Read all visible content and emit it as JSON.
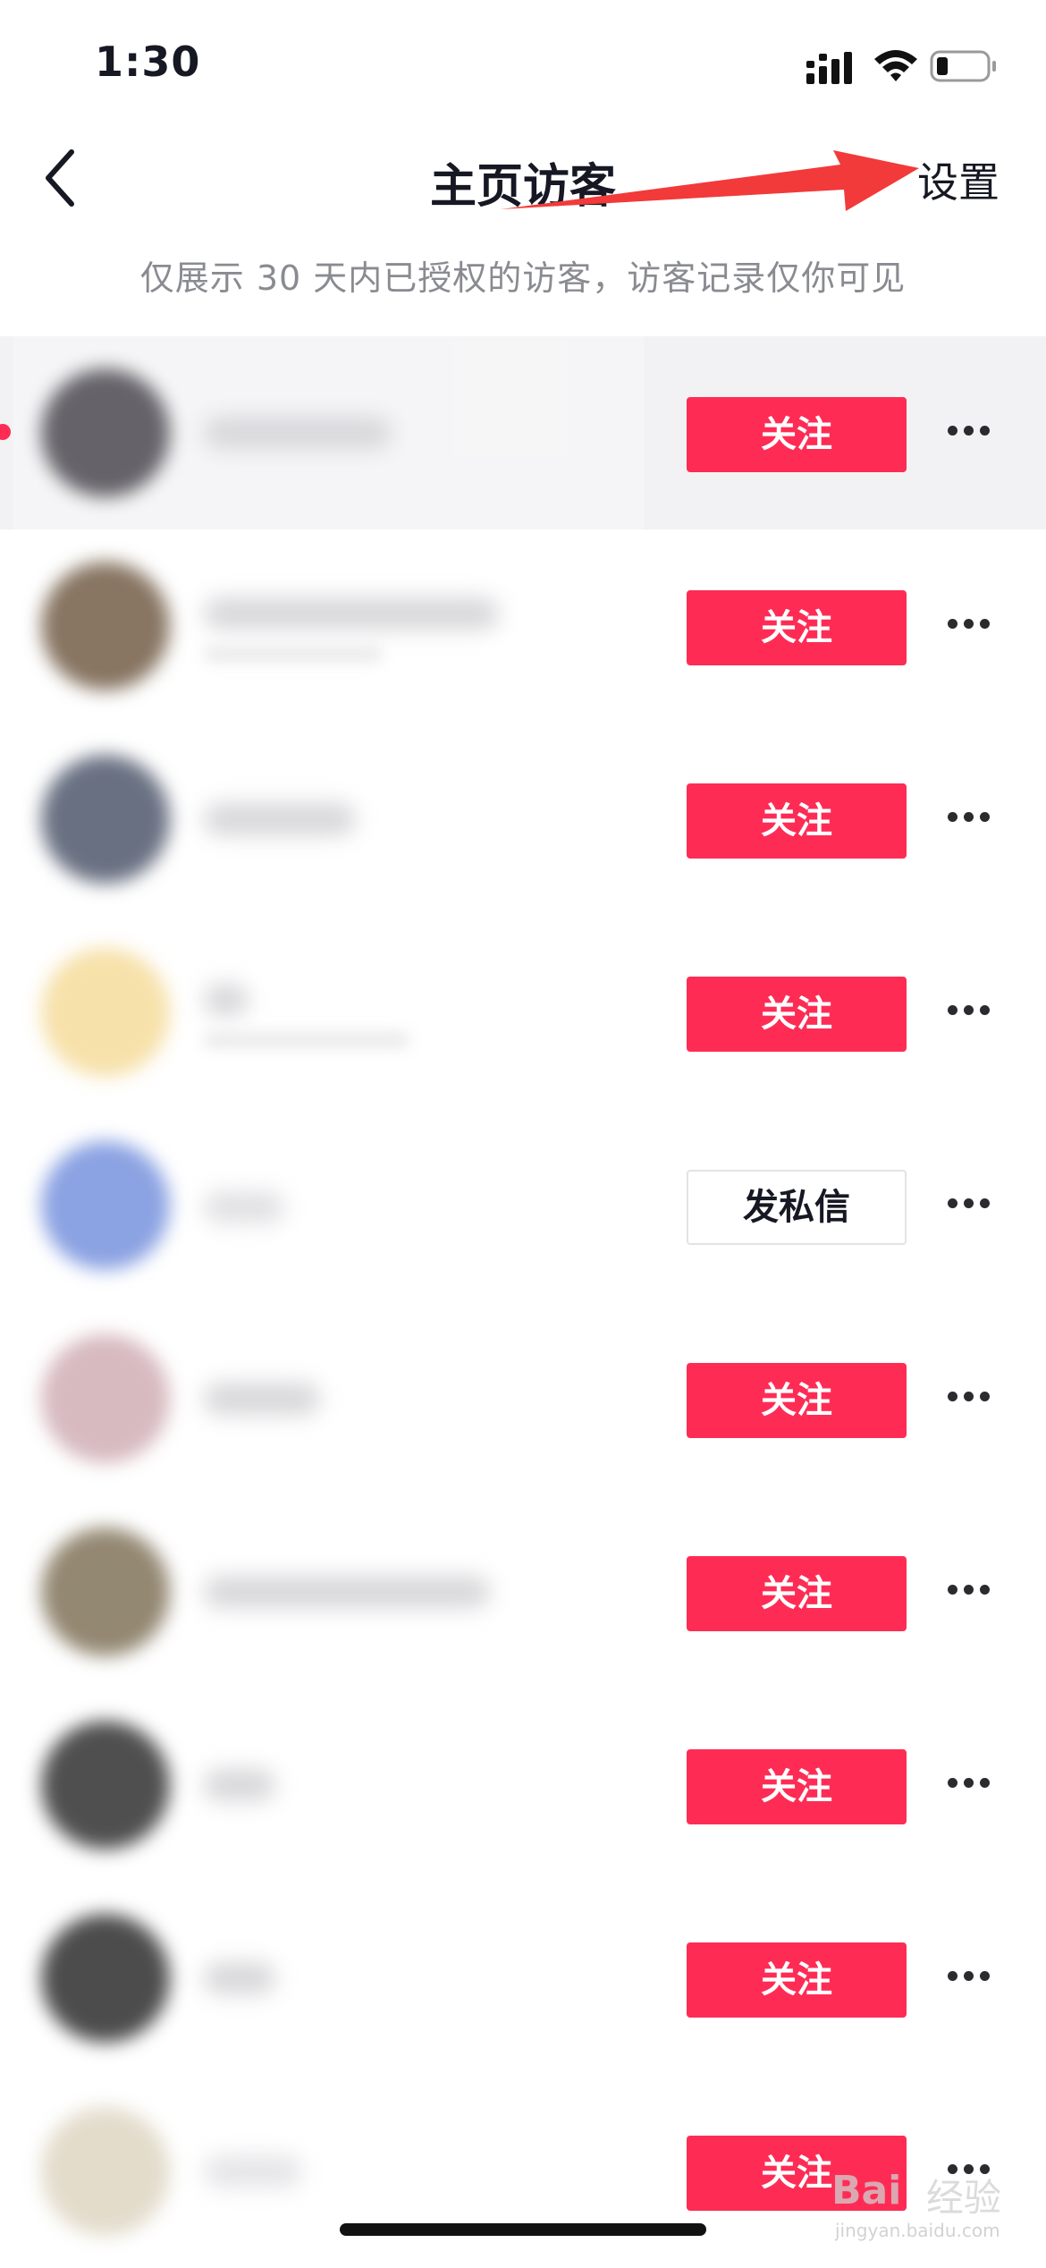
{
  "status_bar": {
    "time": "1:30"
  },
  "nav": {
    "title": "主页访客",
    "settings_label": "设置"
  },
  "subtitle": "仅展示 30 天内已授权的访客，访客记录仅你可见",
  "visitors": [
    {
      "action_label": "关注",
      "action_type": "follow",
      "highlighted": true,
      "unread": true,
      "avatar_color": "#2a2730"
    },
    {
      "action_label": "关注",
      "action_type": "follow",
      "avatar_color": "#5a4026"
    },
    {
      "action_label": "关注",
      "action_type": "follow",
      "avatar_color": "#303a52"
    },
    {
      "action_label": "关注",
      "action_type": "follow",
      "avatar_color": "#f4d68a"
    },
    {
      "action_label": "发私信",
      "action_type": "message",
      "avatar_color": "#5f7fd8"
    },
    {
      "action_label": "关注",
      "action_type": "follow",
      "avatar_color": "#c8a0a8"
    },
    {
      "action_label": "关注",
      "action_type": "follow",
      "avatar_color": "#6a5a3c"
    },
    {
      "action_label": "关注",
      "action_type": "follow",
      "avatar_color": "#0c0c0c"
    },
    {
      "action_label": "关注",
      "action_type": "follow",
      "avatar_color": "#080808"
    },
    {
      "action_label": "关注",
      "action_type": "follow",
      "avatar_color": "#d8cfb8"
    }
  ],
  "icons": {
    "back": "chevron-left-icon",
    "more": "more-horizontal-icon",
    "signal": "signal-icon",
    "wifi": "wifi-icon",
    "battery": "battery-icon"
  },
  "colors": {
    "accent": "#fe2c55",
    "annotation": "#f23a3a",
    "text_primary": "#161823",
    "text_secondary": "#8a8b91"
  },
  "watermark": {
    "brand": "Bai",
    "brand_cn": "经验",
    "url": "jingyan.baidu.com"
  }
}
